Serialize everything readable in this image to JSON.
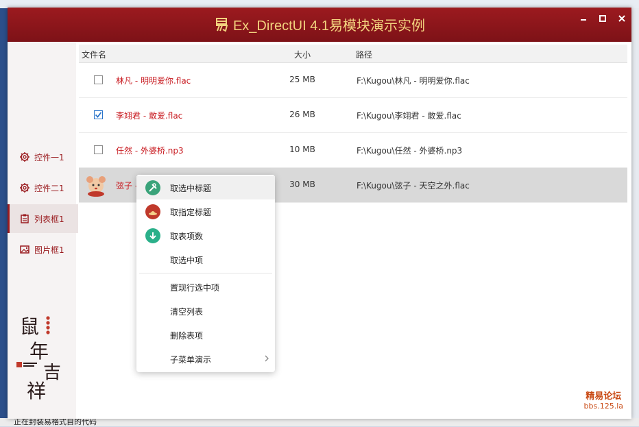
{
  "window": {
    "title": "Ex_DirectUI 4.1易模块演示实例"
  },
  "sidebar": {
    "items": [
      {
        "label": "控件一1",
        "icon": "gear-icon"
      },
      {
        "label": "控件二1",
        "icon": "gear-icon"
      },
      {
        "label": "列表框1",
        "icon": "clipboard-icon",
        "active": true
      },
      {
        "label": "图片框1",
        "icon": "image-icon"
      }
    ]
  },
  "list": {
    "headers": {
      "name": "文件名",
      "size": "大小",
      "path": "路径"
    },
    "rows": [
      {
        "name": "林凡 - 明明爱你.flac",
        "size": "25 MB",
        "path": "F:\\Kugou\\林凡 - 明明爱你.flac",
        "checked": false
      },
      {
        "name": "李翊君 - 敢爱.flac",
        "size": "26 MB",
        "path": "F:\\Kugou\\李翊君 - 敢爱.flac",
        "checked": true
      },
      {
        "name": "任然 - 外婆桥.np3",
        "size": "10 MB",
        "path": "F:\\Kugou\\任然 - 外婆桥.np3",
        "checked": false
      },
      {
        "name": "弦子 -",
        "size": "30 MB",
        "path": "F:\\Kugou\\弦子 - 天空之外.flac",
        "selected": true
      }
    ]
  },
  "context_menu": {
    "items": [
      {
        "label": "取选中标题",
        "icon": "tools-icon",
        "color": "#3aa37a"
      },
      {
        "label": "取指定标题",
        "icon": "hat-icon",
        "color": "#c0392b"
      },
      {
        "label": "取表项数",
        "icon": "download-icon",
        "color": "#2bb08a"
      },
      {
        "label": "取选中项"
      },
      {
        "label": "置现行选中项"
      },
      {
        "label": "清空列表"
      },
      {
        "label": "删除表项"
      },
      {
        "label": "子菜单演示",
        "submenu": true
      }
    ]
  },
  "watermark": {
    "line1": "精易论坛",
    "line2": "bbs.125.la"
  },
  "desktop": {
    "bottom_text": "正在封装易格式自的代码"
  },
  "colors": {
    "brand": "#9c1a1f",
    "accent_text": "#c8191f",
    "title_gold": "#f2d27e"
  }
}
